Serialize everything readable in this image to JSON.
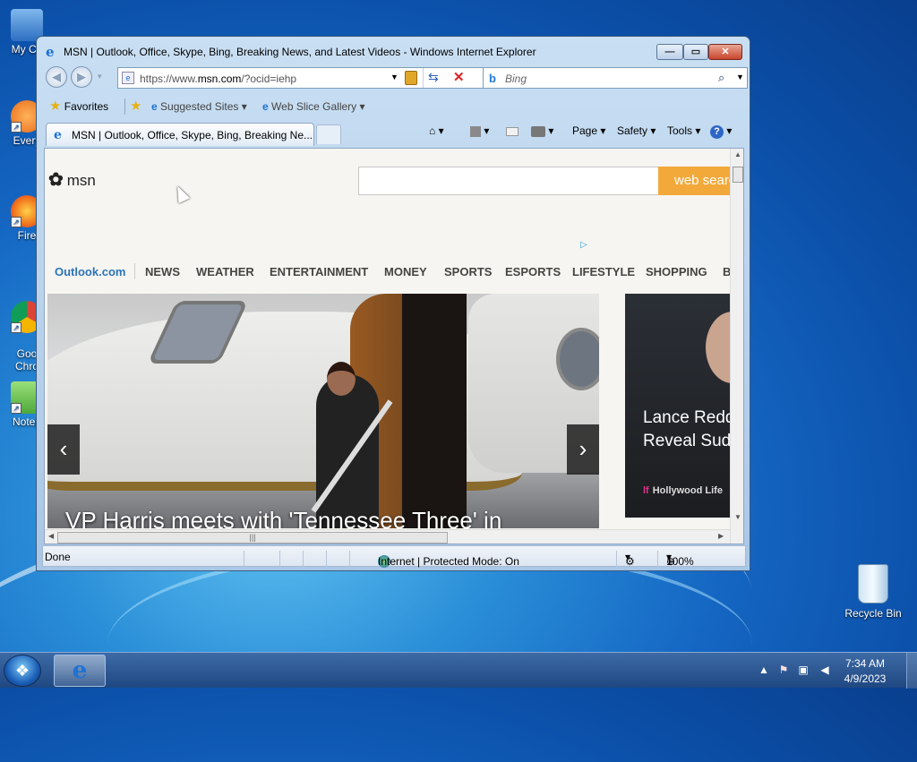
{
  "desktop": {
    "icons": [
      {
        "label": "My Co",
        "color": "#4a8fd8"
      },
      {
        "label": "Every",
        "color": "#e86a1a"
      },
      {
        "label": "Fire",
        "color": "#f0701a"
      },
      {
        "label": "Goo\nChro",
        "color": "#3aa04a"
      },
      {
        "label": "Notep",
        "color": "#6ac04a"
      }
    ],
    "recycle_bin": "Recycle Bin"
  },
  "window": {
    "title": "MSN | Outlook, Office, Skype, Bing, Breaking News, and Latest Videos - Windows Internet Explorer",
    "controls": {
      "minimize": "—",
      "maximize": "▭",
      "close": "✕"
    },
    "address": {
      "url_prefix": "https://www.",
      "url_domain": "msn.com",
      "url_rest": "/?ocid=iehp"
    },
    "search": {
      "placeholder": "Bing",
      "provider_icon": "b"
    },
    "favorites_bar": {
      "favorites": "Favorites",
      "suggested": "Suggested Sites ▾",
      "webslice": "Web Slice Gallery ▾"
    },
    "tab": {
      "title": "MSN | Outlook, Office, Skype, Bing, Breaking Ne..."
    },
    "command_bar": {
      "home": "⌂ ▾",
      "feeds": "▾",
      "print": "▾",
      "page": "Page ▾",
      "safety": "Safety ▾",
      "tools": "Tools ▾",
      "help": "? ▾"
    },
    "status": {
      "left": "Done",
      "zone": "Internet | Protected Mode: On",
      "zoom": "100%"
    }
  },
  "msn": {
    "logo": "msn",
    "search_button": "web search",
    "nav": [
      "Outlook.com",
      "NEWS",
      "WEATHER",
      "ENTERTAINMENT",
      "MONEY",
      "SPORTS",
      "ESPORTS",
      "LIFESTYLE",
      "SHOPPING",
      "B"
    ],
    "hero_caption": "VP Harris meets with 'Tennessee Three' in",
    "card2_caption": "Lance Reddick's Death Reveal Suddenly A",
    "card2_source": "Hollywood Life",
    "accent": "#f3a93a",
    "link_color": "#2b73b8"
  },
  "taskbar": {
    "time": "7:34 AM",
    "date": "4/9/2023"
  }
}
